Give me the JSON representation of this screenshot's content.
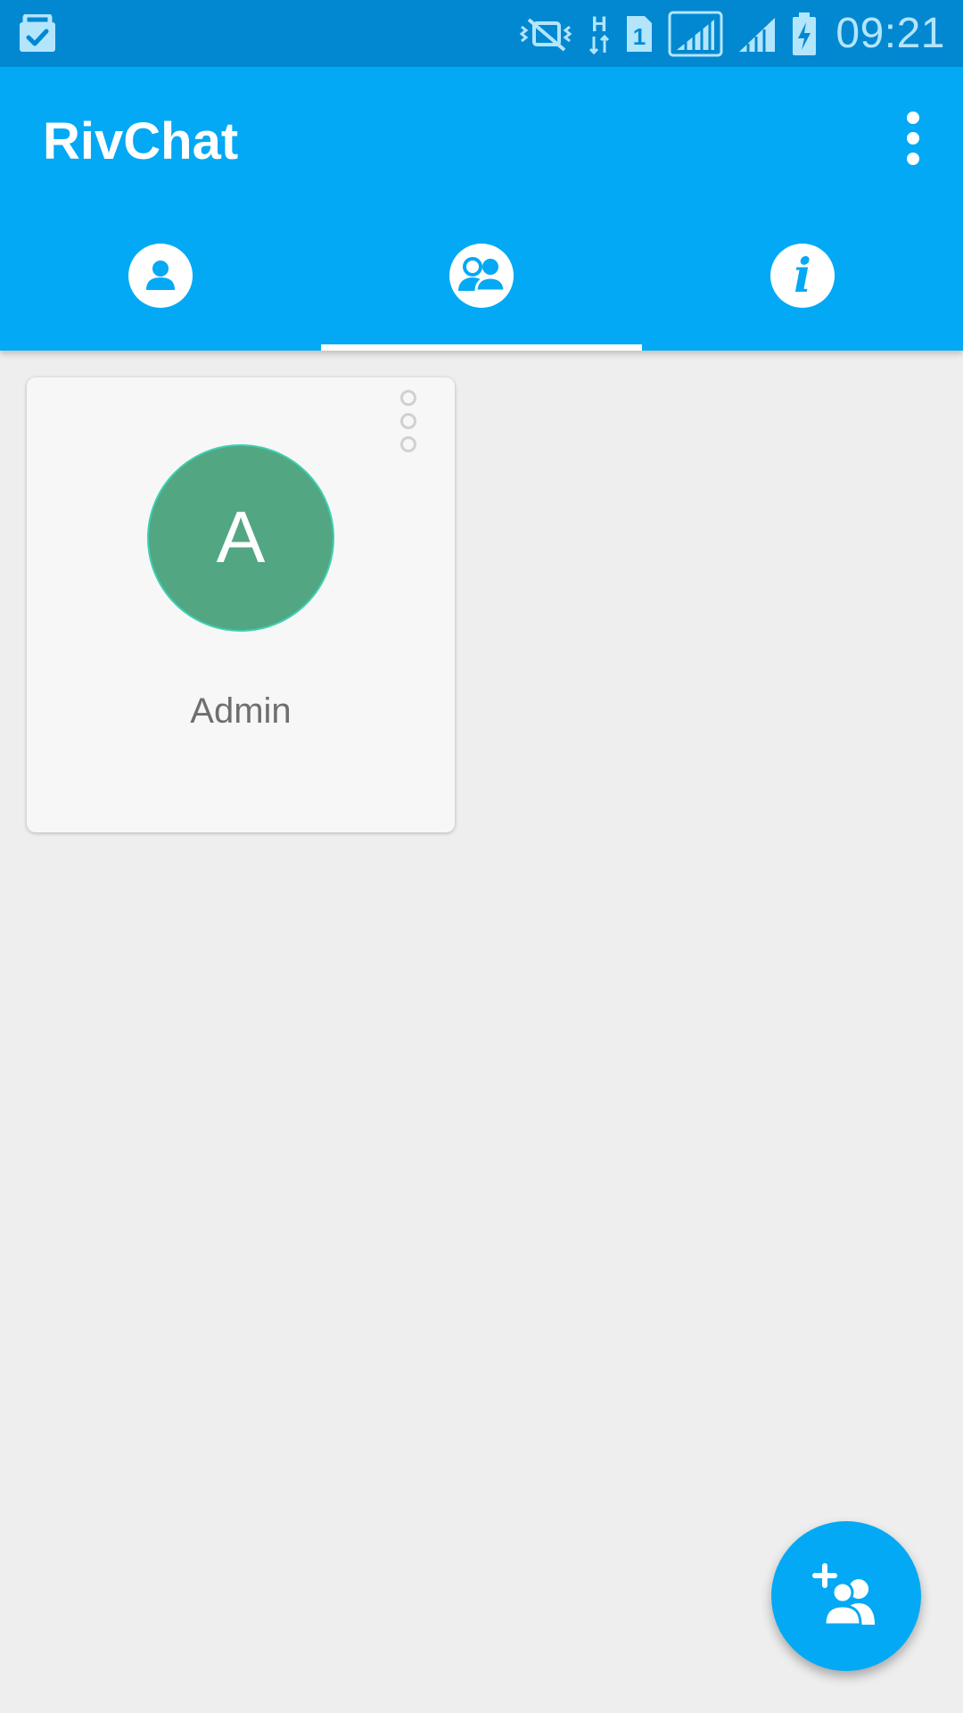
{
  "status_bar": {
    "time": "09:21",
    "left_icon": "briefcase-check-icon",
    "icons": [
      "vibrate-mute-icon",
      "h-data-icon",
      "sim-1-icon",
      "signal-strength-icon",
      "signal-strength-2-icon",
      "battery-charging-icon"
    ]
  },
  "app_bar": {
    "title": "RivChat",
    "menu_icon": "more-vert-icon"
  },
  "tabs": [
    {
      "icon": "person-icon",
      "active": false
    },
    {
      "icon": "group-icon",
      "active": true
    },
    {
      "icon": "info-icon",
      "active": false,
      "glyph": "i"
    }
  ],
  "groups": [
    {
      "avatar_letter": "A",
      "name": "Admin",
      "avatar_color": "#52a782",
      "menu_icon": "more-vert-outline-icon"
    }
  ],
  "fab": {
    "icon": "add-group-icon"
  },
  "colors": {
    "status_bar": "#0288d1",
    "primary": "#03a9f4",
    "background": "#eeeeee",
    "card": "#f7f7f7"
  }
}
